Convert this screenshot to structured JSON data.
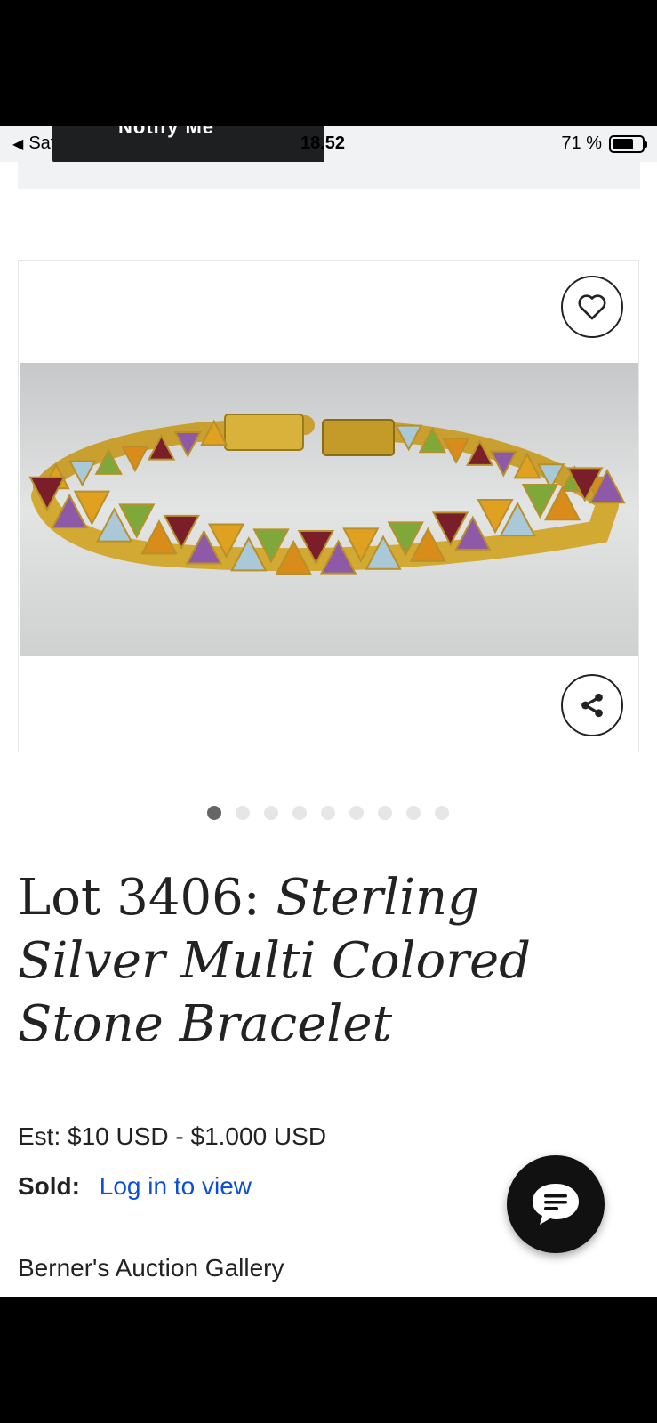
{
  "status_bar": {
    "back_app": "Safari",
    "time": "18.52",
    "battery_percent": "71 %",
    "battery_level": 0.71,
    "notification_fragment": "Notify Me"
  },
  "listing": {
    "lot_prefix": "Lot 3406:",
    "title": "Sterling Silver Multi Colored Stone Bracelet",
    "estimate": "Est: $10 USD - $1.000 USD",
    "sold_label": "Sold:",
    "sold_link": "Log in to view",
    "auction_house": "Berner's Auction Gallery"
  },
  "gallery": {
    "image_count": 9,
    "active_index": 0
  },
  "icons": {
    "favorite": "heart-icon",
    "share": "share-icon",
    "chat": "chat-bubble-icon"
  },
  "colors": {
    "link": "#0a4fd6",
    "text": "#222222",
    "dot_active": "#666666",
    "dot_inactive": "#e6e6e6"
  }
}
